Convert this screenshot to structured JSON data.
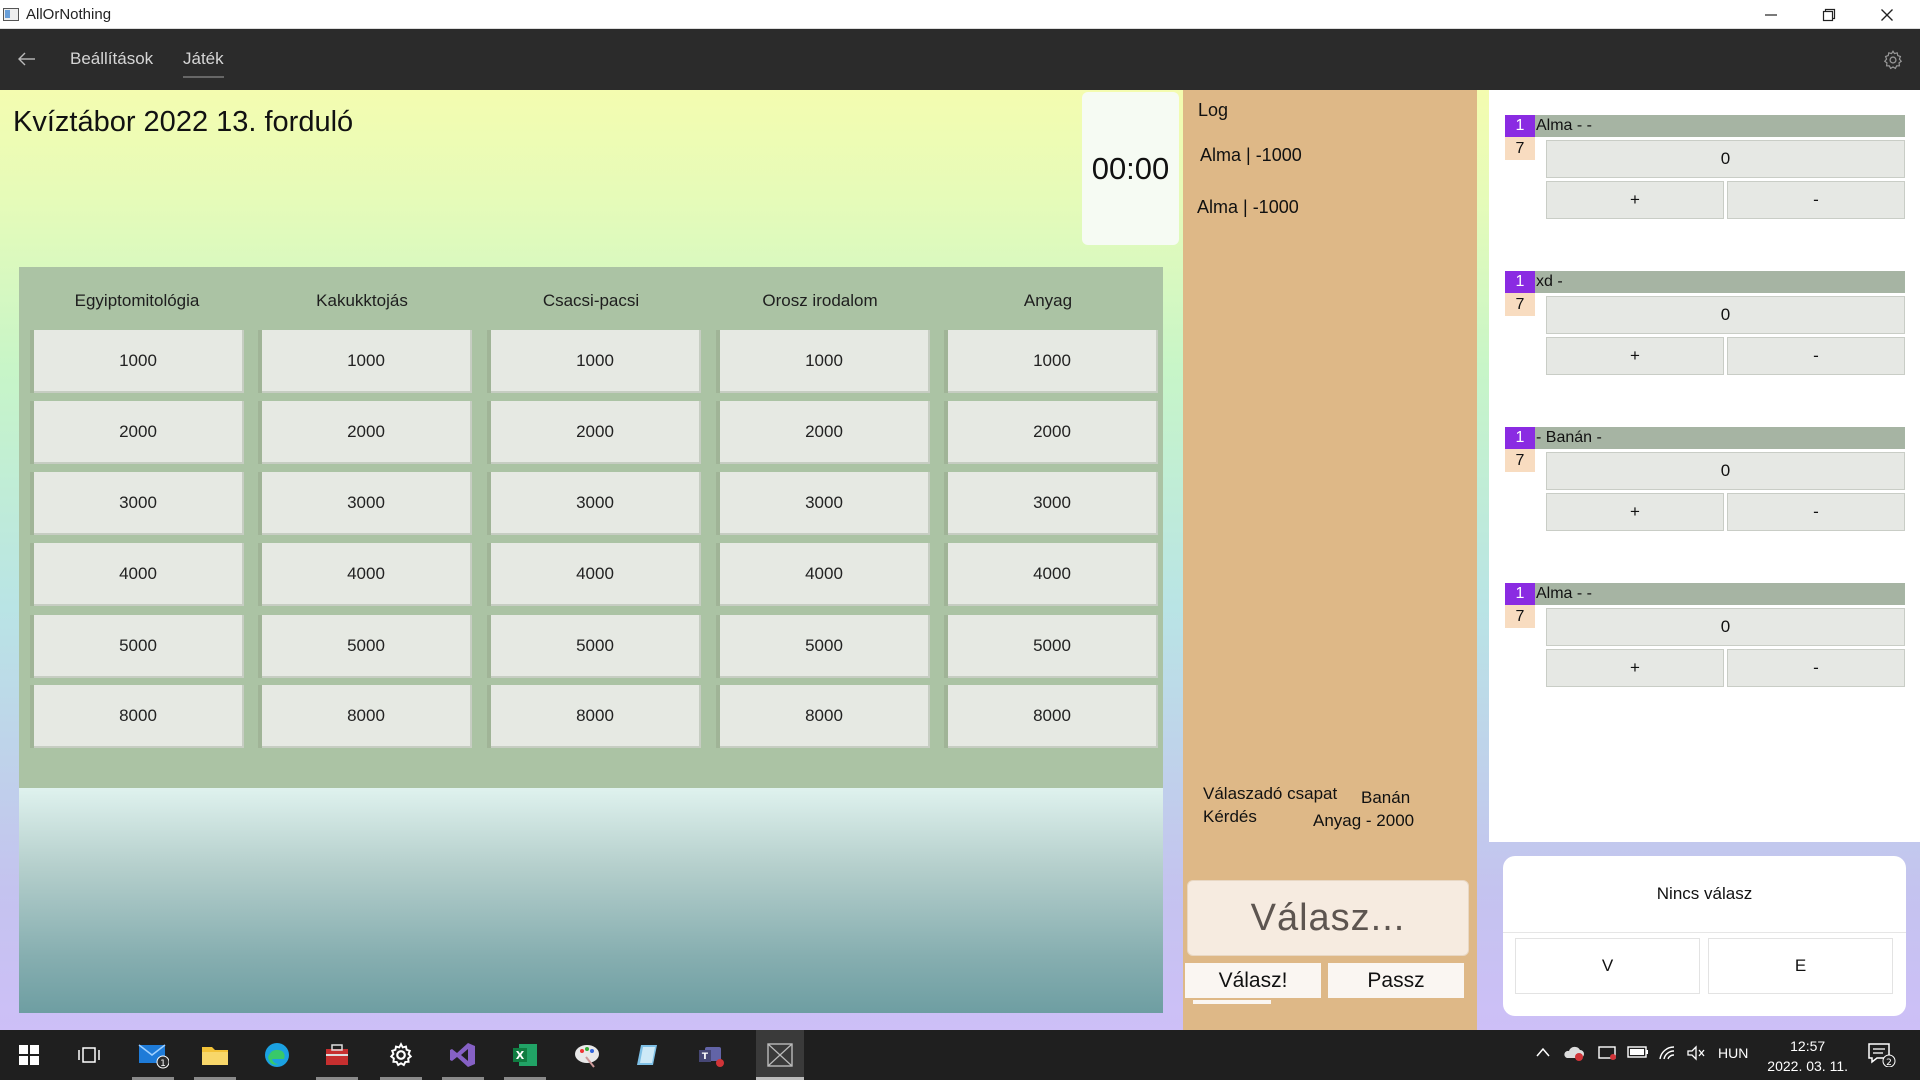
{
  "window": {
    "title": "AllOrNothing",
    "minimize_glyph": "—",
    "restore_glyph": "❐",
    "close_glyph": "✕"
  },
  "appbar": {
    "back_icon": "arrow-left-icon",
    "nav": [
      {
        "label": "Beállítások",
        "active": false
      },
      {
        "label": "Játék",
        "active": true
      }
    ],
    "settings_icon": "gear-icon"
  },
  "quiz": {
    "title": "Kvíztábor 2022 13. forduló",
    "timer": "00:00"
  },
  "board": {
    "categories": [
      "Egyiptomitológia",
      "Kakukktojás",
      "Csacsi-pacsi",
      "Orosz irodalom",
      "Anyag"
    ],
    "rows": [
      [
        "1000",
        "1000",
        "1000",
        "1000",
        "1000"
      ],
      [
        "2000",
        "2000",
        "2000",
        "2000",
        "2000"
      ],
      [
        "3000",
        "3000",
        "3000",
        "3000",
        "3000"
      ],
      [
        "4000",
        "4000",
        "4000",
        "4000",
        "4000"
      ],
      [
        "5000",
        "5000",
        "5000",
        "5000",
        "5000"
      ],
      [
        "8000",
        "8000",
        "8000",
        "8000",
        "8000"
      ]
    ]
  },
  "log": {
    "title": "Log",
    "entries": [
      "Alma | -1000",
      "Alma | -1000"
    ],
    "answering_team_label": "Válaszadó csapat",
    "answering_team": "Banán",
    "question_label": "Kérdés",
    "question": "Anyag - 2000",
    "answer_placeholder": "Válasz...",
    "submit_label": "Válasz!",
    "pass_label": "Passz"
  },
  "teams": [
    {
      "rank": "1",
      "name": "Alma -  -",
      "count": "7",
      "score": "0",
      "plus": "+",
      "minus": "-"
    },
    {
      "rank": "1",
      "name": "xd -",
      "count": "7",
      "score": "0",
      "plus": "+",
      "minus": "-"
    },
    {
      "rank": "1",
      "name": " - Banán -",
      "count": "7",
      "score": "0",
      "plus": "+",
      "minus": "-"
    },
    {
      "rank": "1",
      "name": "Alma -  -",
      "count": "7",
      "score": "0",
      "plus": "+",
      "minus": "-"
    }
  ],
  "judge": {
    "status": "Nincs válasz",
    "correct_label": "V",
    "wrong_label": "E"
  },
  "taskbar": {
    "mail_badge": "1",
    "tray_language": "HUN",
    "time": "12:57",
    "date": "2022. 03. 11.",
    "notification_count": "2"
  },
  "colors": {
    "board_bg": "#abc3a4",
    "log_bg": "#deb887",
    "rank_badge": "#8a2be2",
    "appbar_bg": "#2b2b2b"
  }
}
